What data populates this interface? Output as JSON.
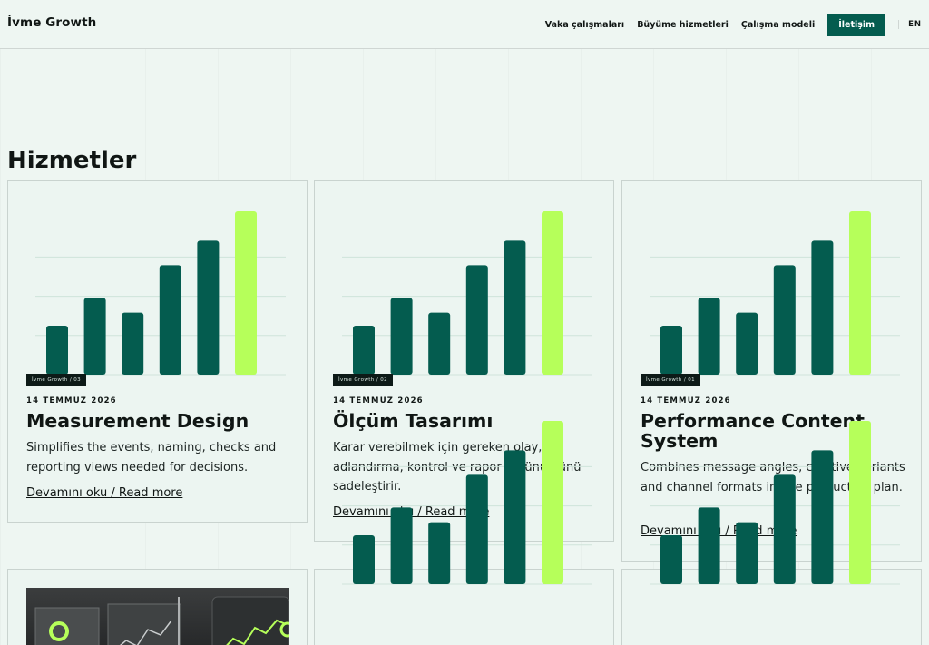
{
  "header": {
    "brand": "İvme Growth",
    "nav": [
      "Vaka çalışmaları",
      "Büyüme hizmetleri",
      "Çalışma modeli"
    ],
    "cta": "İletişim",
    "lang": "EN"
  },
  "section": {
    "title": "Hizmetler"
  },
  "cards": [
    {
      "tag": "İvme Growth / 03",
      "date": "14 TEMMUZ 2026",
      "title": "Measurement Design",
      "desc": "Simplifies the events, naming, checks and reporting views needed for decisions.",
      "more": "Devamını oku / Read more"
    },
    {
      "tag": "İvme Growth / 02",
      "date": "14 TEMMUZ 2026",
      "title": "Ölçüm Tasarımı",
      "desc": "Karar verebilmek için gereken olay, adlandırma, kontrol ve rapor görünümünü sadeleştirir.",
      "more": "Devamını oku / Read more"
    },
    {
      "tag": "İvme Growth / 01",
      "date": "14 TEMMUZ 2026",
      "title": "Performance Content System",
      "desc": "Combines message angles, creative variants and channel formats in one production plan.",
      "more": "Devamını oku / Read more"
    }
  ],
  "chart_data": {
    "type": "bar",
    "categories": [
      "1",
      "2",
      "3",
      "4",
      "5",
      "6"
    ],
    "values": [
      30,
      47,
      38,
      67,
      82,
      100
    ],
    "ylim": [
      0,
      100
    ],
    "colors": {
      "bar": "#045c4f",
      "highlight": "#b6ff5a",
      "grid": "#cfe3da"
    }
  },
  "colors": {
    "accent": "#045c4f",
    "lime": "#b6ff5a",
    "background": "#eef6f2"
  }
}
